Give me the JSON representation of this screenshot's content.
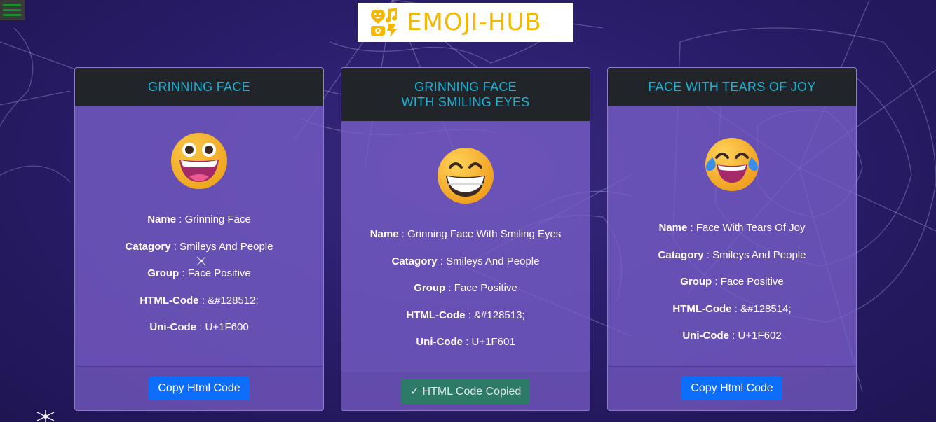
{
  "app": {
    "logo_text": "EMOJI-HUB"
  },
  "labels": {
    "name": "Name",
    "category": "Catagory",
    "group": "Group",
    "html_code": "HTML-Code",
    "uni_code": "Uni-Code",
    "sep": " : "
  },
  "cards": [
    {
      "title_lines": [
        "GRINNING FACE"
      ],
      "name": "Grinning Face",
      "category": "Smileys And People",
      "group": "Face Positive",
      "html_code": "&#128512;",
      "uni_code": "U+1F600",
      "button_label": "Copy Html Code",
      "button_state": "default"
    },
    {
      "title_lines": [
        "GRINNING FACE",
        "WITH SMILING EYES"
      ],
      "name": "Grinning Face With Smiling Eyes",
      "category": "Smileys And People",
      "group": "Face Positive",
      "html_code": "&#128513;",
      "uni_code": "U+1F601",
      "button_label": "✓ HTML Code Copied",
      "button_state": "copied"
    },
    {
      "title_lines": [
        "FACE WITH TEARS OF JOY"
      ],
      "name": "Face With Tears Of Joy",
      "category": "Smileys And People",
      "group": "Face Positive",
      "html_code": "&#128514;",
      "uni_code": "U+1F602",
      "button_label": "Copy Html Code",
      "button_state": "default"
    }
  ],
  "colors": {
    "title": "#17b4d8",
    "logo": "#f5b800",
    "primary_button": "#0d6efd",
    "copied_button": "#2d7a68"
  }
}
